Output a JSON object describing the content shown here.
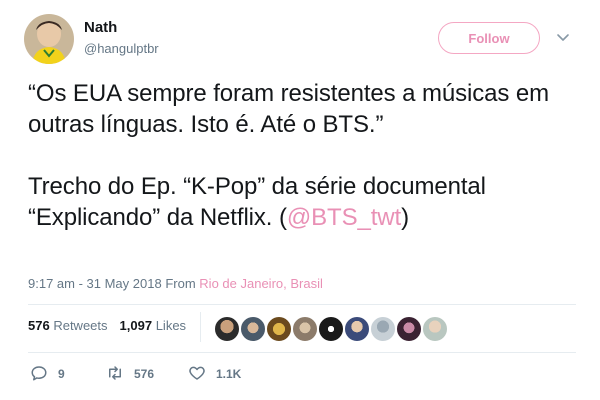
{
  "user": {
    "name": "Nath",
    "handle": "@hangulptbr"
  },
  "follow_button": {
    "label": "Follow"
  },
  "tweet": {
    "line1": "“Os EUA sempre foram resistentes a músicas em outras línguas. Isto é. Até o BTS.”",
    "line2_prefix": "Trecho do Ep. “K-Pop” da série documental “Explicando” da Netflix. (",
    "mention": "@BTS_twt",
    "line2_suffix": ")"
  },
  "meta": {
    "time": "9:17 am - 31 May 2018",
    "from_label": "From",
    "location": "Rio de Janeiro, Brasil"
  },
  "stats": {
    "retweets_count": "576",
    "retweets_label": "Retweets",
    "likes_count": "1,097",
    "likes_label": "Likes"
  },
  "actions": {
    "replies": "9",
    "retweets": "576",
    "likes": "1.1K"
  },
  "colors": {
    "accent": "#e990b5",
    "muted": "#657786",
    "text": "#14171a"
  },
  "icons": [
    "avatar",
    "chevron-down-icon",
    "reply-icon",
    "retweet-icon",
    "heart-icon"
  ]
}
